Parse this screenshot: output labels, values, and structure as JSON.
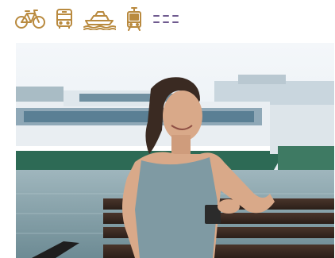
{
  "colors": {
    "icon": "#b98a3f",
    "icon_dashes": "#6f5a8f",
    "sky": "#eef3f7",
    "water": "#8aa9b4",
    "boat_hull": "#2d6a55",
    "bench": "#3a2a22",
    "top": "#7f9aa3",
    "skin": "#d9a989",
    "hair": "#3a2a22"
  },
  "transport_modes": [
    {
      "name": "bicycle-icon"
    },
    {
      "name": "bus-icon"
    },
    {
      "name": "ferry-icon"
    },
    {
      "name": "tram-icon"
    },
    {
      "name": "more-dashes-icon"
    }
  ],
  "hero": {
    "subject": "woman-on-bench-by-ferry"
  }
}
